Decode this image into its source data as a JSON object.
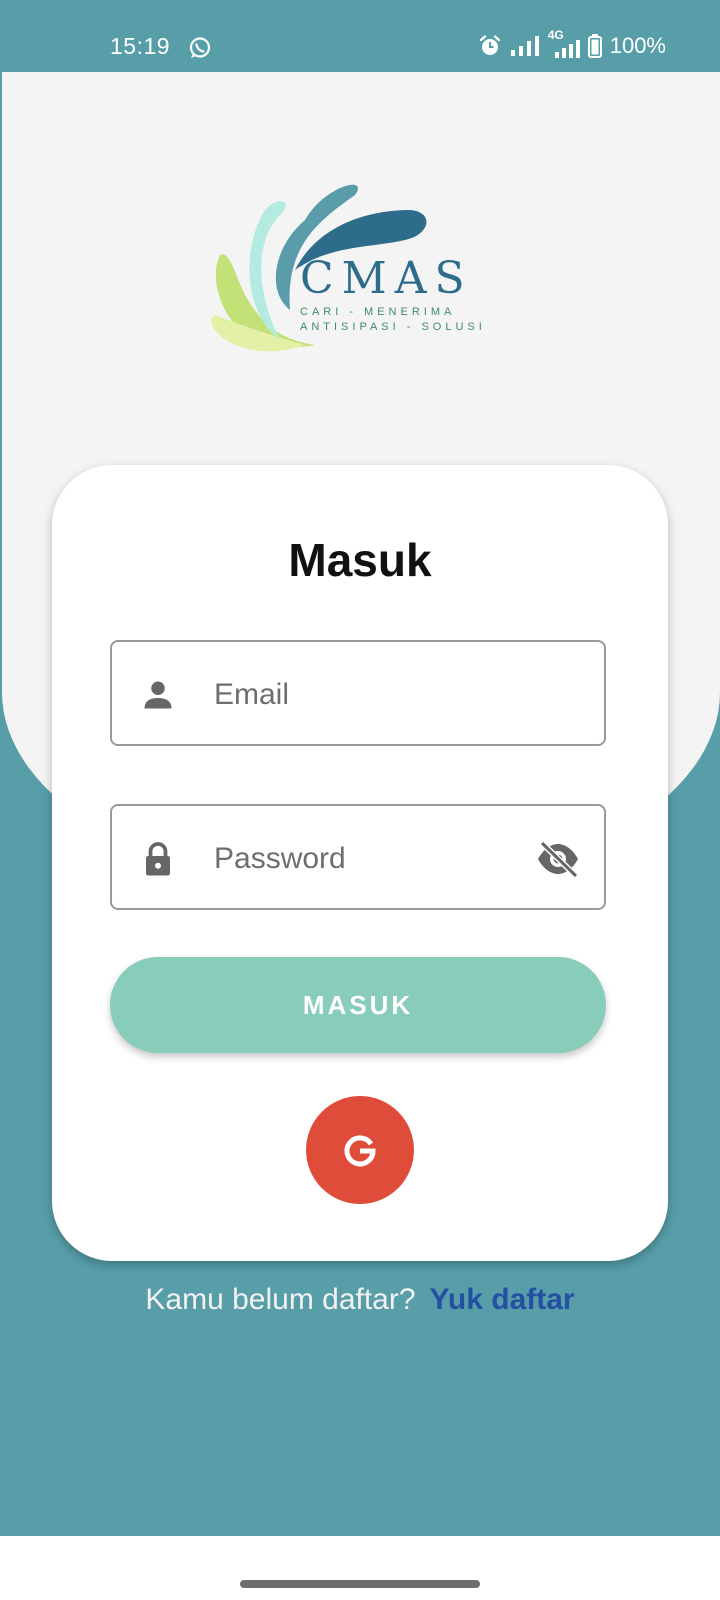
{
  "status_bar": {
    "time": "15:19",
    "battery": "100%",
    "network": "4G",
    "icons": [
      "whatsapp-icon",
      "alarm-icon",
      "signal-icon",
      "signal-4g-icon",
      "battery-icon"
    ]
  },
  "logo": {
    "brand": "CMAS",
    "tagline_line1": "CARI - MENERIMA",
    "tagline_line2": "ANTISIPASI - SOLUSI"
  },
  "login": {
    "title": "Masuk",
    "email_placeholder": "Email",
    "password_placeholder": "Password",
    "submit_label": "MASUK",
    "google_label": "G"
  },
  "footer": {
    "prompt": "Kamu belum daftar?",
    "link": "Yuk daftar"
  },
  "colors": {
    "primary": "#579ea9",
    "button": "#88ccba",
    "google": "#df4c3a",
    "link": "#2450a4"
  }
}
